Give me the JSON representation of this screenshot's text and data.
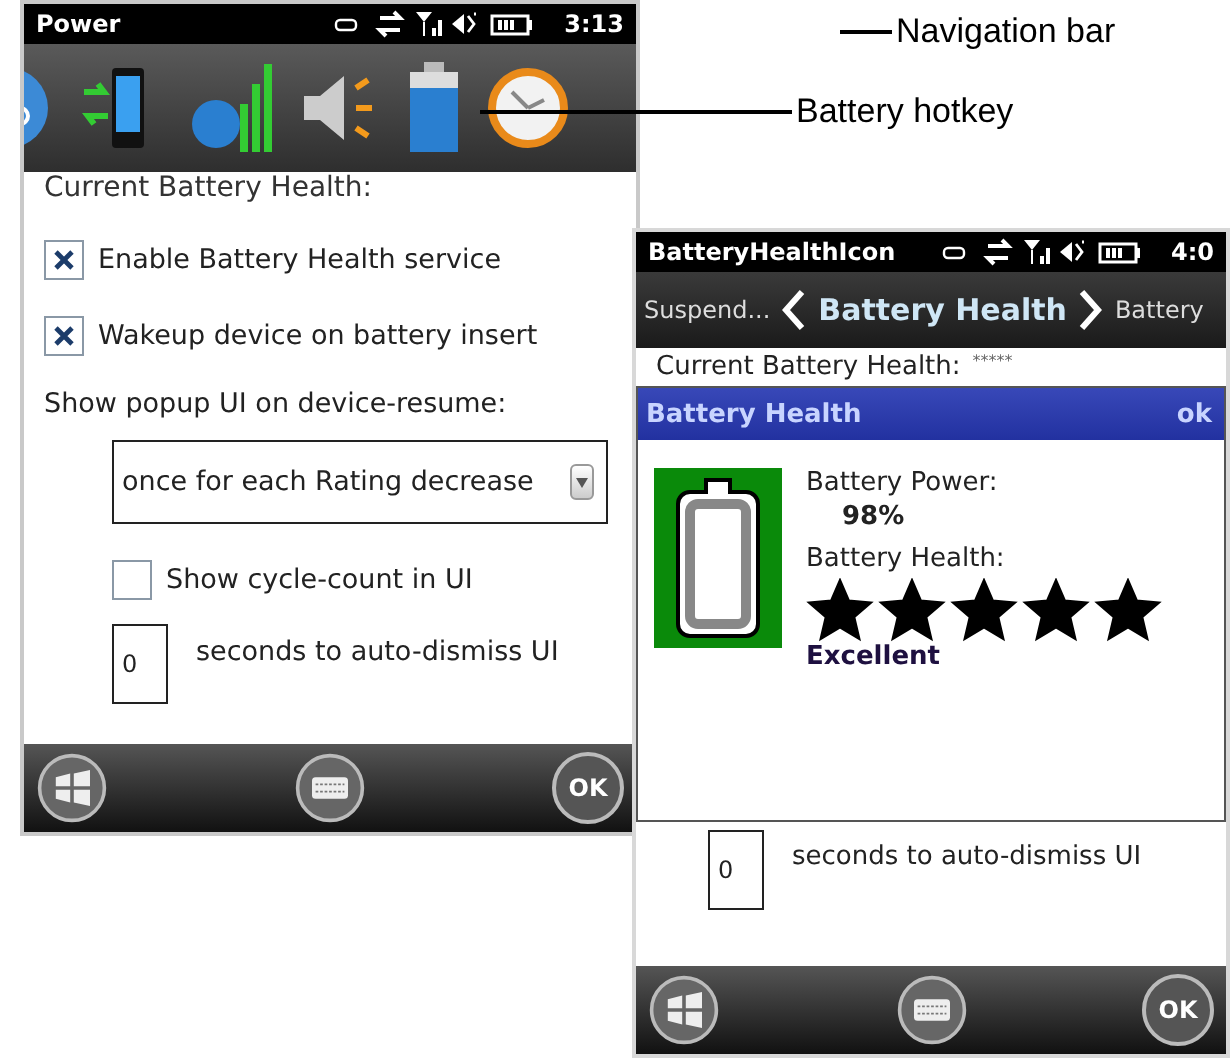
{
  "left_screen": {
    "status_bar": {
      "title": "Power",
      "time": "3:13"
    },
    "content": {
      "heading": "Current Battery Health:",
      "options": [
        {
          "label": "Enable Battery Health service",
          "checked": true
        },
        {
          "label": "Wakeup device on battery insert",
          "checked": true
        }
      ],
      "popup_label": "Show popup UI on device-resume:",
      "popup_dropdown": {
        "value": "once for each Rating decrease"
      },
      "cycle_count": {
        "label": "Show cycle-count in UI",
        "checked": false
      },
      "dismiss": {
        "value": "0",
        "label": "seconds to auto-dismiss UI"
      }
    },
    "ok_key": "OK"
  },
  "right_screen": {
    "status_bar": {
      "title": "BatteryHealthIcon",
      "time": "4:0"
    },
    "nav": {
      "previous": "Suspend...",
      "current": "Battery Health",
      "next": "Battery"
    },
    "current_health": {
      "label": "Current Battery Health:",
      "value": "*****"
    },
    "dialog": {
      "title": "Battery Health",
      "ok": "ok",
      "power_label": "Battery Power:",
      "power": "98%",
      "health_label": "Battery Health:",
      "stars": 5,
      "rating": "Excellent"
    },
    "dismiss": {
      "value": "0",
      "label": "seconds to auto-dismiss UI"
    },
    "ok_key": "OK"
  },
  "callouts": [
    {
      "label": "Navigation bar"
    },
    {
      "label": "Battery hotkey"
    }
  ]
}
